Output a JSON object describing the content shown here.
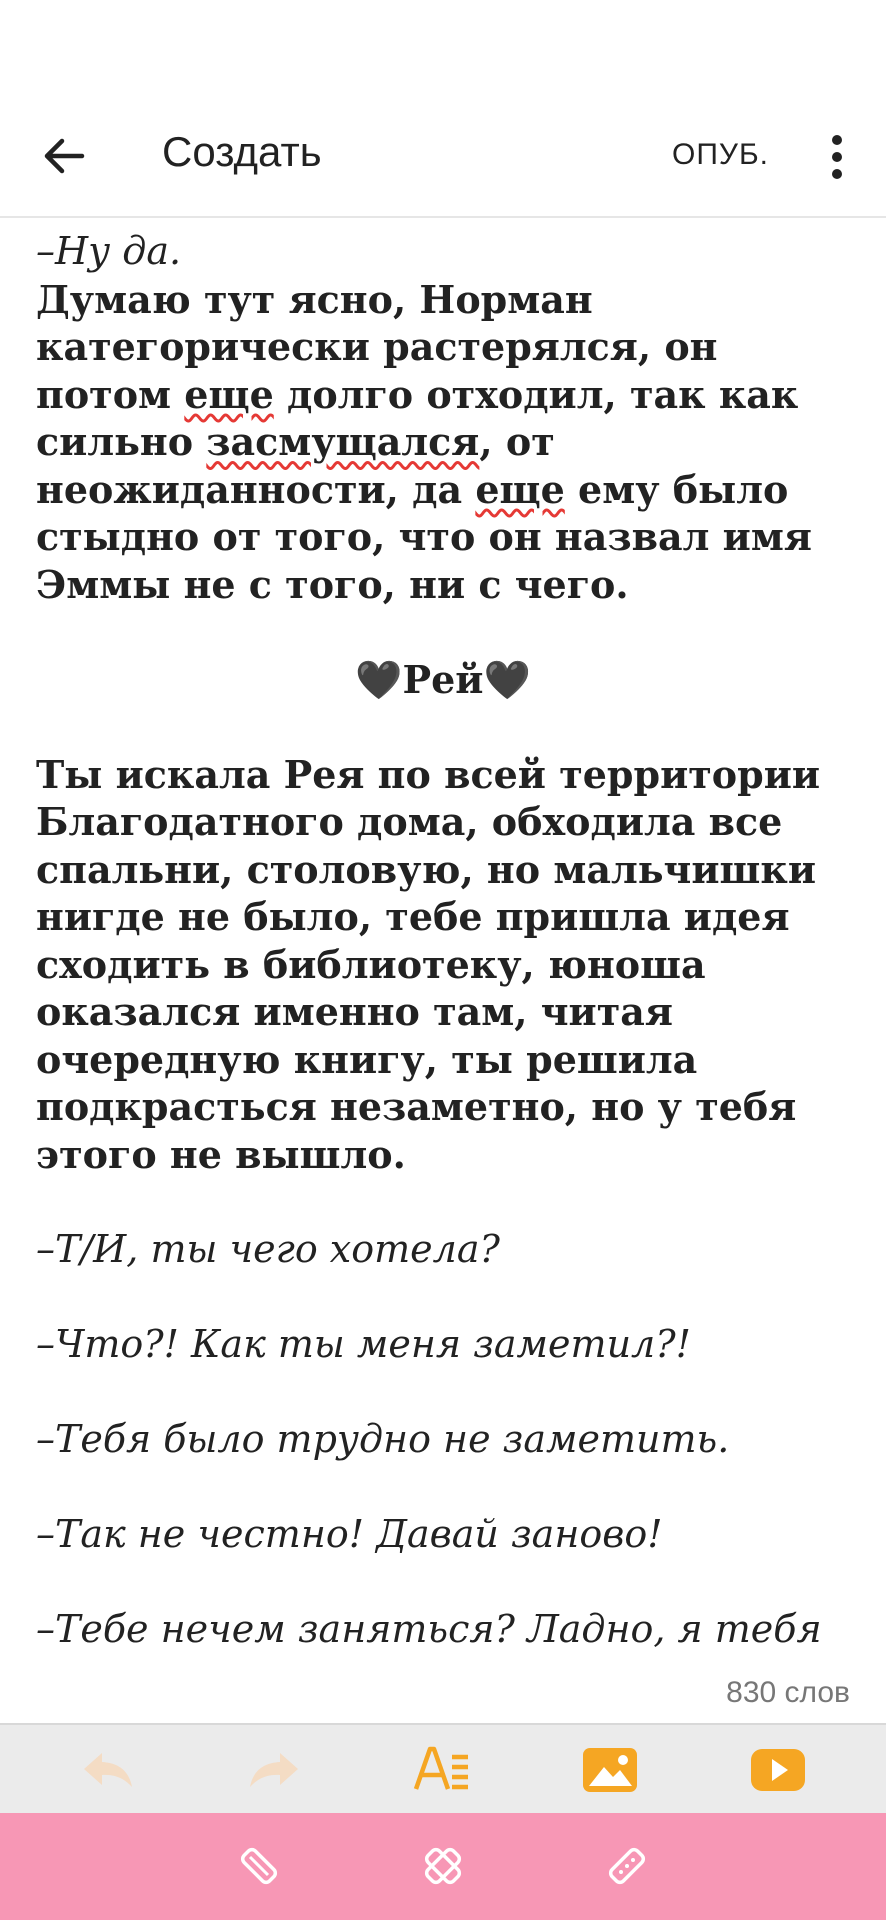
{
  "appbar": {
    "title": "Создать",
    "publish_label": "ОПУБ.",
    "back_icon": "arrow-left-icon",
    "more_icon": "kebab-vertical-icon"
  },
  "story": {
    "line1": "–Ну да.",
    "p2_a": "Думаю тут ясно, Норман категорически растерялся, он потом ",
    "p2_w1": "еще",
    "p2_b": " долго отходил, так как сильно ",
    "p2_w2": "засмущался",
    "p2_c": ", от неожиданности, да ",
    "p2_w3": "еще",
    "p2_d": " ему было стыдно от того, что он назвал имя Эммы не с того, ни с чего.",
    "heading": "🖤Рей🖤",
    "p3": "Ты искала Рея по всей территории Благодатного дома, обходила все спальни, столовую, но мальчишки нигде не было, тебе пришла идея сходить в библиотеку, юноша оказался именно там, читая очередную книгу, ты решила подкрасться незаметно, но у тебя этого не вышло.",
    "d1": "–Т/И, ты чего хотела?",
    "d2": "–Что?! Как ты меня заметил?!",
    "d3": "–Тебя было трудно не заметить.",
    "d4": "–Так не честно! Давай заново!",
    "d5": "–Тебе нечем заняться? Ладно, я тебя"
  },
  "word_count": "830 слов",
  "colors": {
    "accent_orange": "#f5a623",
    "bottom_bar": "#f797b5",
    "spell_underline": "#e53935"
  },
  "toolbar_icons": [
    "undo-icon",
    "redo-icon",
    "text-format-icon",
    "image-icon",
    "video-icon"
  ],
  "bottom_icons": [
    "diagonal-tool-icon",
    "close-x-icon",
    "diagonal-tool-alt-icon"
  ]
}
